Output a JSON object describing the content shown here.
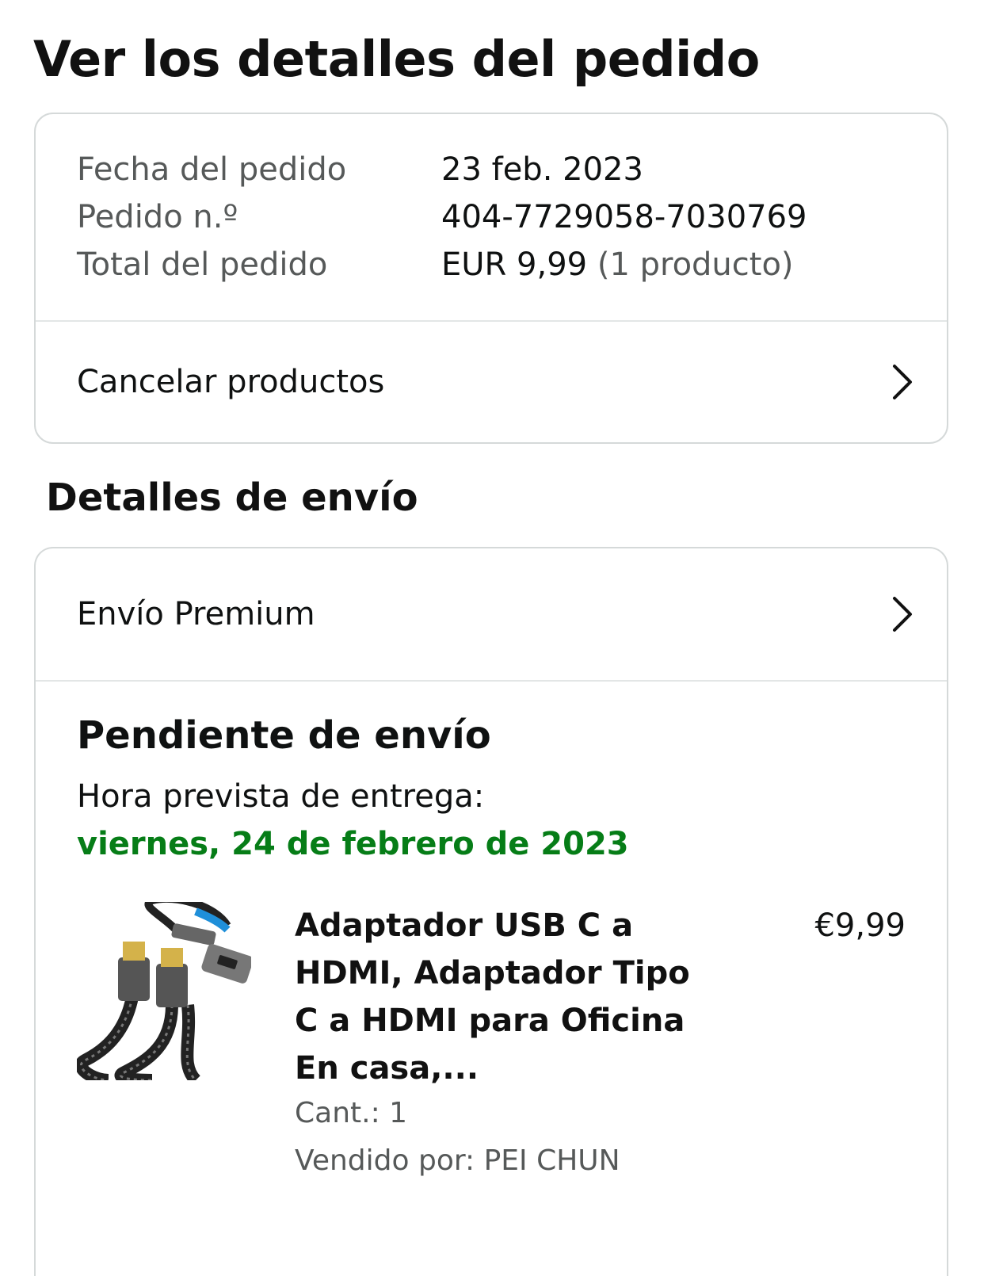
{
  "page": {
    "title": "Ver los detalles del pedido"
  },
  "order_summary": {
    "rows": [
      {
        "label": "Fecha del pedido",
        "value": "23 feb. 2023"
      },
      {
        "label": "Pedido n.º",
        "value": "404-7729058-7030769"
      },
      {
        "label": "Total del pedido",
        "value": "EUR 9,99",
        "extra": "(1 producto)"
      }
    ],
    "cancel_label": "Cancelar productos"
  },
  "shipping": {
    "section_title": "Detalles de envío",
    "method_label": "Envío Premium",
    "status": "Pendiente de envío",
    "eta_label": "Hora prevista de entrega:",
    "eta_date": "viernes, 24 de febrero de 2023"
  },
  "product": {
    "title": "Adaptador USB C a HDMI, Adaptador Tipo C a HDMI para Oficina En casa,...",
    "price": "€9,99",
    "quantity": "Cant.: 1",
    "seller": "Vendido por: PEI CHUN"
  },
  "colors": {
    "accent_green": "#067d17",
    "border": "#d5d9d9",
    "muted_text": "#565959"
  },
  "icons": {
    "row_chevron": "chevron-right-icon"
  }
}
